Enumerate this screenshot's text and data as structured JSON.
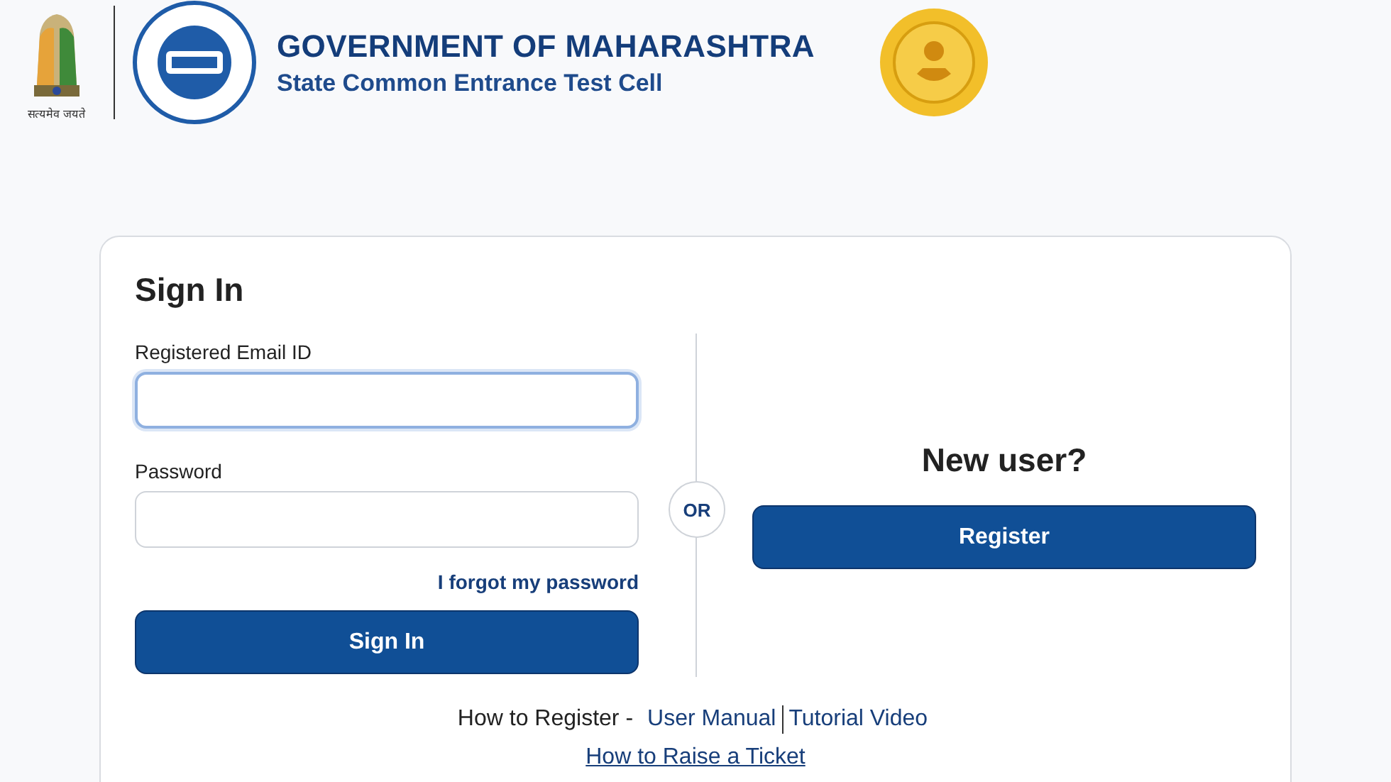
{
  "header": {
    "emblem_motto": "सत्यमेव जयते",
    "title": "GOVERNMENT OF MAHARASHTRA",
    "subtitle": "State Common Entrance Test Cell"
  },
  "sign_in": {
    "heading": "Sign In",
    "email_label": "Registered Email ID",
    "email_focused": true,
    "password_label": "Password",
    "forgot_link": "I forgot my password",
    "button": "Sign In"
  },
  "separator": "OR",
  "new_user": {
    "heading": "New user?",
    "button": "Register"
  },
  "help": {
    "prefix": "How to Register -",
    "links": [
      "User Manual",
      "Tutorial Video"
    ],
    "ticket_link": "How to Raise a Ticket"
  }
}
